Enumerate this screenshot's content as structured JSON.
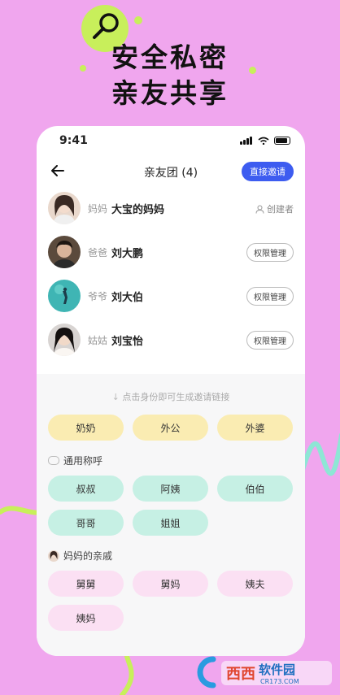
{
  "headline": {
    "line1": "安全私密",
    "line2": "亲友共享"
  },
  "status": {
    "time": "9:41"
  },
  "nav": {
    "title": "亲友团 (4)",
    "invite_label": "直接邀请"
  },
  "members": [
    {
      "role": "妈妈",
      "name": "大宝的妈妈",
      "tag": "创建者"
    },
    {
      "role": "爸爸",
      "name": "刘大鹏",
      "action": "权限管理"
    },
    {
      "role": "爷爷",
      "name": "刘大伯",
      "action": "权限管理"
    },
    {
      "role": "姑姑",
      "name": "刘宝怡",
      "action": "权限管理"
    }
  ],
  "hint": "点击身份即可生成邀请链接",
  "primary_roles": [
    "奶奶",
    "外公",
    "外婆"
  ],
  "common": {
    "label": "通用称呼",
    "roles": [
      "叔叔",
      "阿姨",
      "伯伯",
      "哥哥",
      "姐姐"
    ]
  },
  "relatives": {
    "label": "妈妈的亲戚",
    "roles": [
      "舅舅",
      "舅妈",
      "姨夫",
      "姨妈"
    ]
  },
  "watermark": {
    "brand": "西西软件园",
    "site": "CR173.COM"
  },
  "colors": {
    "background": "#f0a6ee",
    "accent": "#3d5cf0",
    "lime": "#c8ef5b",
    "mint_chip": "#c6f0e4",
    "yellow_chip": "#faecb2",
    "pink_chip": "#fbe0f3"
  }
}
